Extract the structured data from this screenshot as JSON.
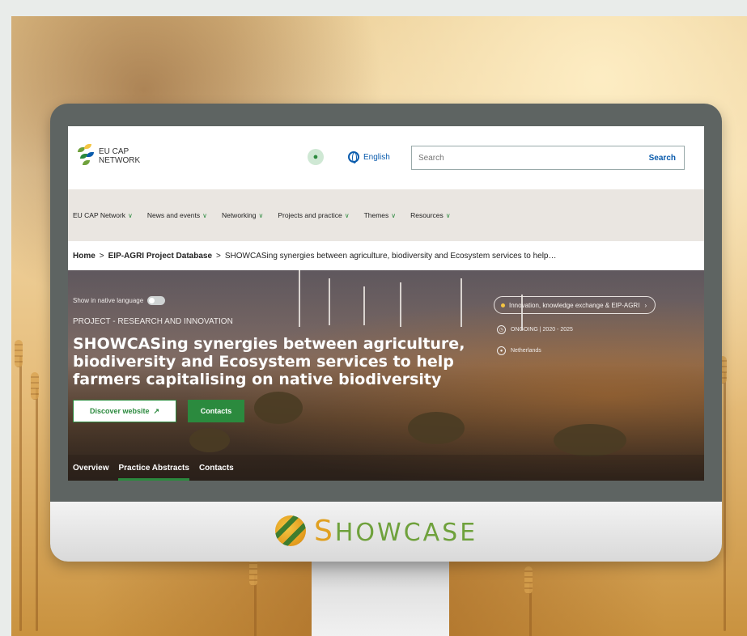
{
  "site": {
    "logo_text_line1": "EU CAP",
    "logo_text_line2": "NETWORK",
    "language": "English",
    "search_placeholder": "Search",
    "search_button": "Search"
  },
  "nav": {
    "items": [
      {
        "label": "EU CAP Network"
      },
      {
        "label": "News and events"
      },
      {
        "label": "Networking"
      },
      {
        "label": "Projects and practice"
      },
      {
        "label": "Themes"
      },
      {
        "label": "Resources"
      }
    ]
  },
  "breadcrumb": {
    "home": "Home",
    "separator": ">",
    "database": "EIP-AGRI Project Database",
    "current": "SHOWCASing synergies between agriculture, biodiversity and Ecosystem services to help…"
  },
  "hero": {
    "native_language_label": "Show in native language",
    "project_type": "PROJECT - RESEARCH AND INNOVATION",
    "title": "SHOWCASing synergies between agriculture, biodiversity and Ecosystem services to help farmers capitalising on native biodiversity",
    "discover_button": "Discover website",
    "contacts_button": "Contacts",
    "tag": "Innovation, knowledge exchange & EIP-AGRI",
    "status": "ONGOING | 2020 - 2025",
    "country": "Netherlands"
  },
  "tabs": [
    {
      "label": "Overview"
    },
    {
      "label": "Practice Abstracts"
    },
    {
      "label": "Contacts"
    }
  ],
  "brand": {
    "name_first": "S",
    "name_rest": "HOWCASE"
  },
  "colors": {
    "accent_green": "#2b8a3e",
    "link_blue": "#0b5cad"
  }
}
